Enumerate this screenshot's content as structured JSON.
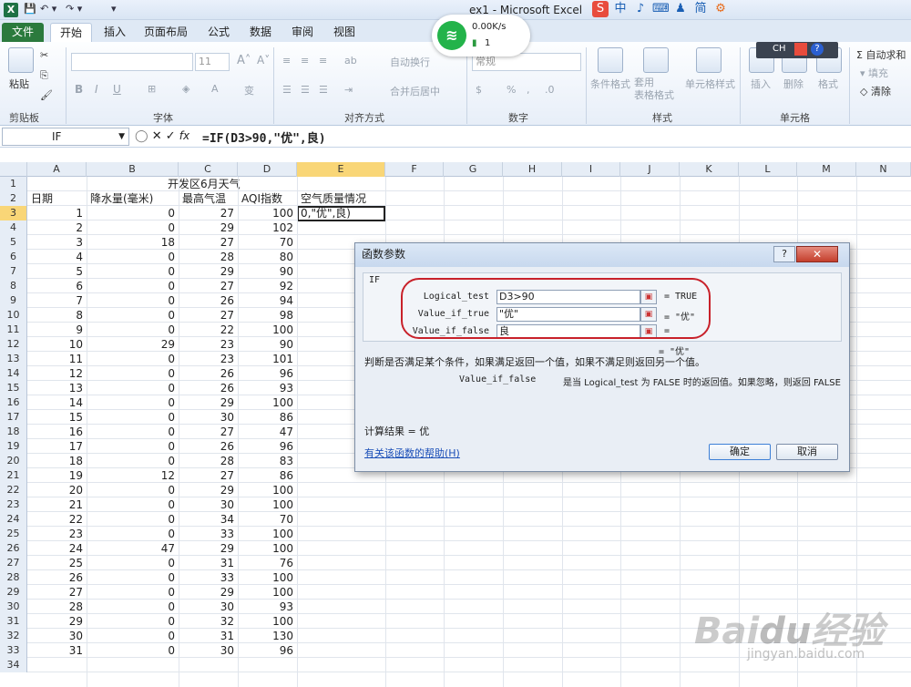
{
  "app": {
    "window_title": "ex1 - Microsoft Excel",
    "quick_access": [
      "💾",
      "↶ ▾",
      "↷ ▾",
      "▾"
    ]
  },
  "ime": {
    "items": [
      "中",
      "♪",
      "⌨",
      "简",
      "⚙"
    ]
  },
  "wifi": {
    "speed": "0.00K/s",
    "count": "1"
  },
  "tabs": [
    "文件",
    "开始",
    "插入",
    "页面布局",
    "公式",
    "数据",
    "审阅",
    "视图"
  ],
  "ribbon": {
    "paste": "粘贴",
    "groups": [
      "剪贴板",
      "字体",
      "对齐方式",
      "数字",
      "样式",
      "单元格"
    ],
    "font_size": "11",
    "wrap_text": "自动换行",
    "merge_center": "合并后居中",
    "number_format": "常规",
    "cond_format": "条件格式",
    "table_format": "套用\n表格格式",
    "cell_style": "单元格样式",
    "insert": "插入",
    "delete": "删除",
    "format": "格式",
    "autosum": "Σ 自动求和",
    "fill": "填充",
    "clear": "清除",
    "lang_badge": "CH"
  },
  "formula_bar": {
    "name_box": "IF",
    "formula": "=IF(D3>90,\"优\",良)"
  },
  "columns": [
    "A",
    "B",
    "C",
    "D",
    "E",
    "F",
    "G",
    "H",
    "I",
    "J",
    "K",
    "L",
    "M",
    "N"
  ],
  "sheet": {
    "title": "开发区6月天气",
    "headers": [
      "日期",
      "降水量(毫米)",
      "最高气温",
      "AQI指数",
      "空气质量情况"
    ],
    "e3_edit": "0,\"优\",良)",
    "rows": [
      [
        1,
        0,
        27,
        100
      ],
      [
        2,
        0,
        29,
        102
      ],
      [
        3,
        18,
        27,
        70
      ],
      [
        4,
        0,
        28,
        80
      ],
      [
        5,
        0,
        29,
        90
      ],
      [
        6,
        0,
        27,
        92
      ],
      [
        7,
        0,
        26,
        94
      ],
      [
        8,
        0,
        27,
        98
      ],
      [
        9,
        0,
        22,
        100
      ],
      [
        10,
        29,
        23,
        90
      ],
      [
        11,
        0,
        23,
        101
      ],
      [
        12,
        0,
        26,
        96
      ],
      [
        13,
        0,
        26,
        93
      ],
      [
        14,
        0,
        29,
        100
      ],
      [
        15,
        0,
        30,
        86
      ],
      [
        16,
        0,
        27,
        47
      ],
      [
        17,
        0,
        26,
        96
      ],
      [
        18,
        0,
        28,
        83
      ],
      [
        19,
        12,
        27,
        86
      ],
      [
        20,
        0,
        29,
        100
      ],
      [
        21,
        0,
        30,
        100
      ],
      [
        22,
        0,
        34,
        70
      ],
      [
        23,
        0,
        33,
        100
      ],
      [
        24,
        47,
        29,
        100
      ],
      [
        25,
        0,
        31,
        76
      ],
      [
        26,
        0,
        33,
        100
      ],
      [
        27,
        0,
        29,
        100
      ],
      [
        28,
        0,
        30,
        93
      ],
      [
        29,
        0,
        32,
        100
      ],
      [
        30,
        0,
        31,
        130
      ],
      [
        31,
        0,
        30,
        96
      ]
    ],
    "row_numbers": [
      "1",
      "2",
      "3",
      "4",
      "5",
      "6",
      "7",
      "8",
      "9",
      "10",
      "11",
      "12",
      "13",
      "14",
      "15",
      "16",
      "17",
      "18",
      "19",
      "20",
      "21",
      "22",
      "23",
      "24",
      "25",
      "26",
      "27",
      "28",
      "29",
      "30",
      "31",
      "32",
      "33",
      "34"
    ]
  },
  "dialog": {
    "title": "函数参数",
    "function_name": "IF",
    "args": [
      {
        "label": "Logical_test",
        "value": "D3>90",
        "result": "= TRUE"
      },
      {
        "label": "Value_if_true",
        "value": "\"优\"",
        "result": "= \"优\""
      },
      {
        "label": "Value_if_false",
        "value": "良",
        "result": "="
      }
    ],
    "overall": "= \"优\"",
    "description": "判断是否满足某个条件，如果满足返回一个值，如果不满足则返回另一个值。",
    "arg_help_name": "Value_if_false",
    "arg_help": "是当 Logical_test 为 FALSE 时的返回值。如果忽略，则返回 FALSE",
    "calc_result": "计算结果 = 优",
    "help_link": "有关该函数的帮助(H)",
    "ok": "确定",
    "cancel": "取消",
    "help_btn": "?",
    "close_btn": "✕"
  },
  "watermark": {
    "logo": "Baidu经验",
    "url": "jingyan.baidu.com"
  }
}
